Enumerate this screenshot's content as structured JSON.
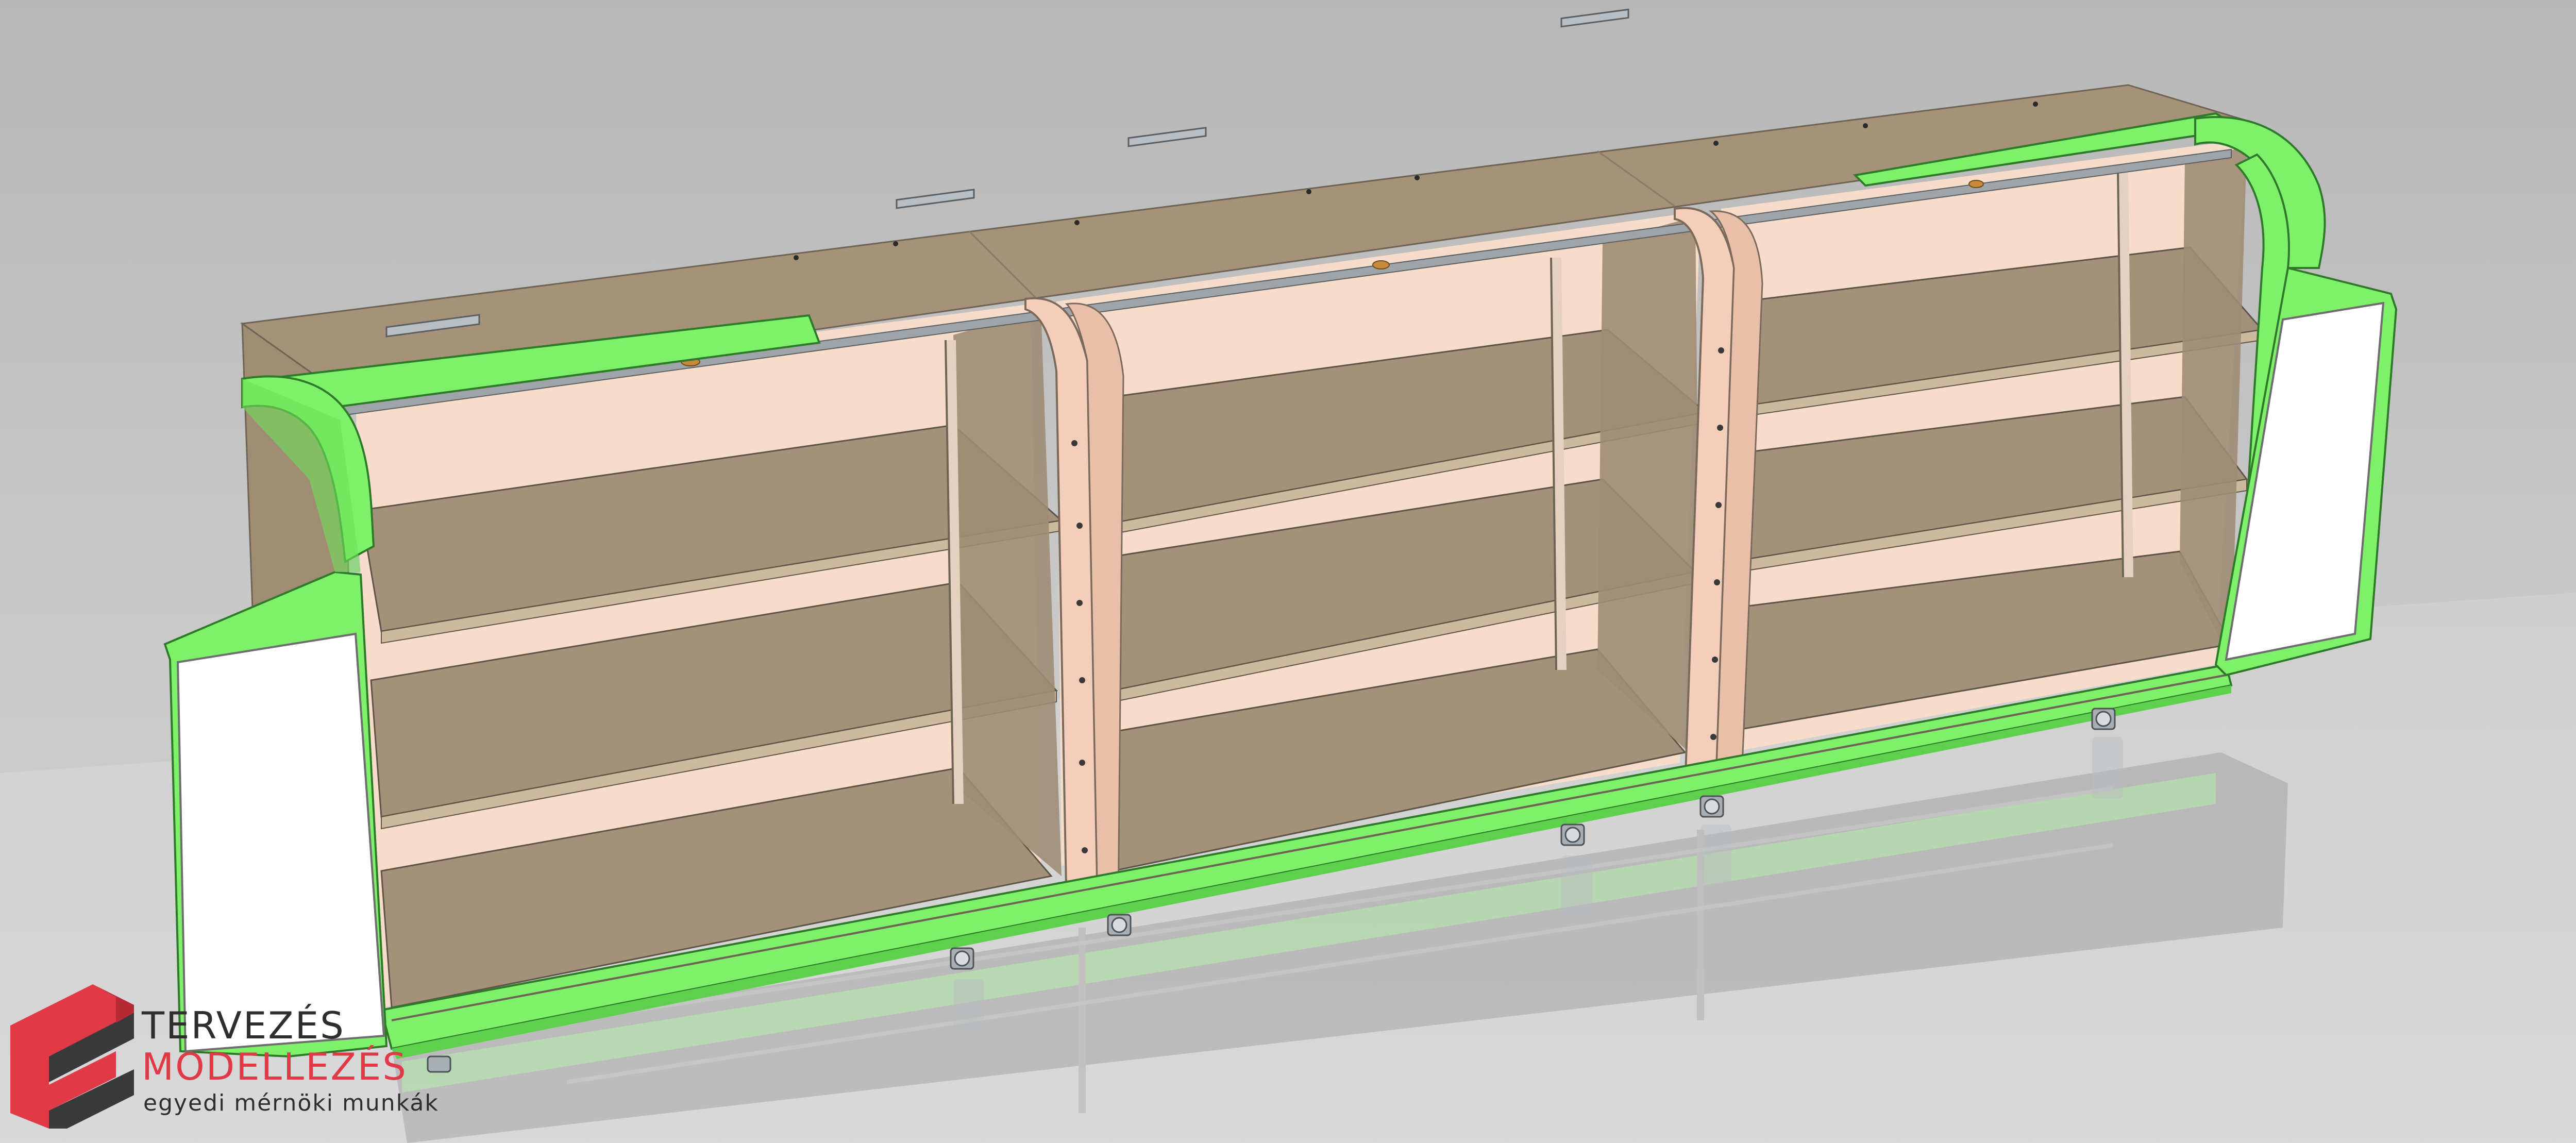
{
  "logo": {
    "line1": "TERVEZÉS",
    "line2": "MODELLEZÉS",
    "line3": "egyedi mérnöki munkák",
    "colors": {
      "red": "#e03a46",
      "dark": "#3a3a3a",
      "text_dark": "#2e2e2e"
    }
  },
  "colors": {
    "background": "#c4c4c4",
    "green": "#7ef06a",
    "green_dark": "#3f9e38",
    "wood": "#a39179",
    "wood_light": "#b8a78e",
    "panel_back": "#f6d8c8",
    "divider": "#f2cdb8",
    "white_panel": "#ffffff",
    "metal": "#9ea4a8"
  }
}
